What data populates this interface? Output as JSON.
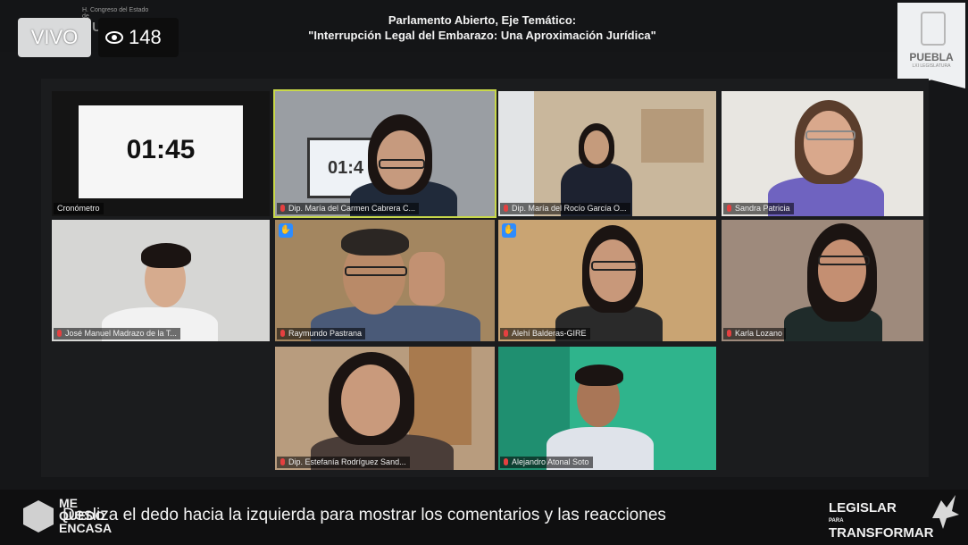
{
  "header": {
    "title_line1": "Parlamento Abierto, Eje Temático:",
    "title_line2": "\"Interrupción Legal del Embarazo: Una Aproximación Jurídica\"",
    "left_logo_small": "H. Congreso del Estado de",
    "left_logo_big": "PUEBLA",
    "right_logo_name": "PUEBLA",
    "right_logo_sub": "LXI LEGISLATURA"
  },
  "live": {
    "badge": "VIVO",
    "viewer_count": "148"
  },
  "tiles": [
    {
      "label": "Cronómetro",
      "clock": "01:45"
    },
    {
      "label": "Dip. María del Carmen Cabrera C...",
      "screen_clock": "01:4"
    },
    {
      "label": "Dip. María del Rocío García O..."
    },
    {
      "label": "Sandra Patricia"
    },
    {
      "label": "José Manuel Madrazo de la T..."
    },
    {
      "label": "Raymundo Pastrana"
    },
    {
      "label": "Alehí Balderas-GIRE"
    },
    {
      "label": "Karla Lozano"
    },
    {
      "label": "Dip. Estefanía Rodríguez Sand..."
    },
    {
      "label": "Alejandro Atonal Soto"
    }
  ],
  "footer": {
    "swipe_hint": "Desliza el dedo hacia la izquierda para mostrar los comentarios y las reacciones",
    "left_brand": "ME QUEDO EN CASA",
    "left_brand_1": "ME",
    "left_brand_2": "QUEDO",
    "left_brand_3": "ENCASA",
    "right_brand_1": "LEGISLAR",
    "right_brand_para": "PARA",
    "right_brand_2": "TRANSFORMAR"
  },
  "colors": {
    "active_speaker_border": "#c8d84a",
    "raised_hand": "#2d8cff",
    "muted_mic": "#e54040"
  }
}
